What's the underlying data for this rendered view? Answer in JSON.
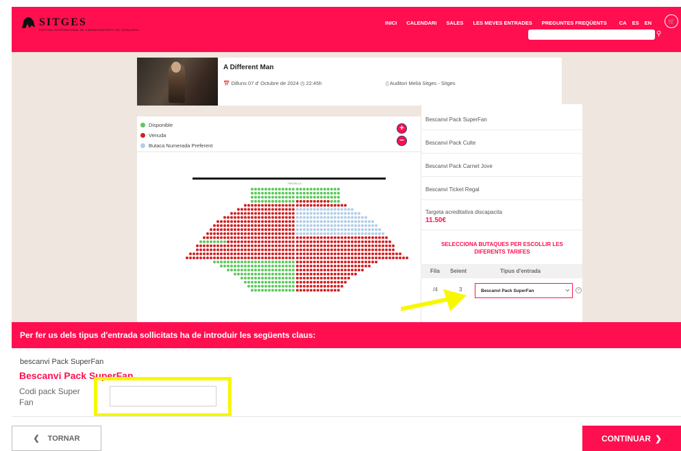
{
  "brand": {
    "name": "SITGES",
    "tagline": "FESTIVAL INTERNACIONAL DE CINEMA FANTÀSTIC DE CATALUNYA"
  },
  "nav": {
    "items": [
      "INICI",
      "CALENDARI",
      "SALES",
      "LES MEVES ENTRADES",
      "PREGUNTES FREQÜENTS"
    ],
    "langs": [
      "CA",
      "ES",
      "EN"
    ]
  },
  "search": {
    "placeholder": ""
  },
  "event": {
    "title": "A Different Man",
    "date": "Dilluns 07 d' Octubre de 2024",
    "time": "22:45h",
    "venue": "Auditori Melià Sitges - Sitges"
  },
  "legend": {
    "available": "Disponible",
    "sold": "Venuda",
    "preferent": "Butaca Numerada Preferent"
  },
  "seatmap": {
    "screen_label": "PANTALLA"
  },
  "rates": {
    "items": [
      "Bescanvi Pack SuperFan",
      "Bescanvi Pack Culte",
      "Bescanvi Pack Carnet Jove",
      "Bescanvi Ticket Regal",
      "Targeta acreditativa discapacita"
    ],
    "price": "11.50€",
    "prompt": "SELECCIONA BUTAQUES PER ESCOLLIR LES DIFERENTS TARIFES",
    "headers": {
      "row": "Fila",
      "seat": "Seient",
      "type": "Tipus d'entrada"
    },
    "selection": {
      "row": "/4",
      "seat": "3",
      "type": "Bescanvi Pack SuperFan"
    }
  },
  "keys": {
    "banner": "Per fer us dels tipus d'entrada sollicitats ha de introduir les següents claus:",
    "subtitle": "bescanvi Pack SuperFan",
    "title": "Bescanvi Pack SuperFan",
    "label": "Codi pack Super Fan",
    "value": ""
  },
  "buttons": {
    "back": "TORNAR",
    "continue": "CONTINUAR"
  },
  "colors": {
    "brand": "#ff0f4f",
    "available": "#5cc95c",
    "sold": "#d31f22",
    "preferent": "#b3cde8",
    "highlight": "#f7f700"
  }
}
